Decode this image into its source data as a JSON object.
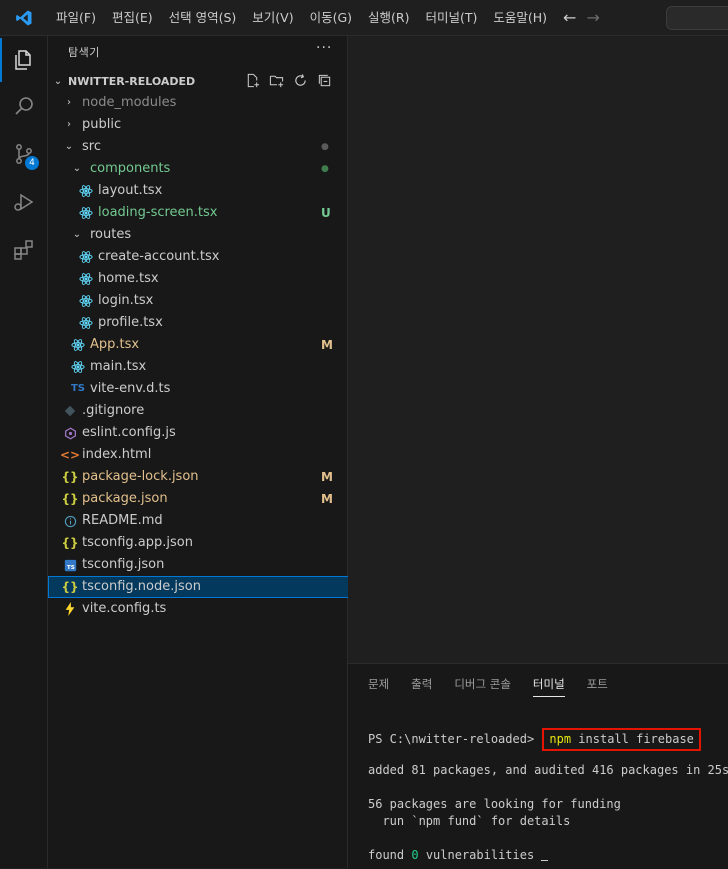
{
  "menu": {
    "items": [
      "파일(F)",
      "편집(E)",
      "선택 영역(S)",
      "보기(V)",
      "이동(G)",
      "실행(R)",
      "터미널(T)",
      "도움말(H)"
    ]
  },
  "activity_bar": {
    "source_control_badge": "4"
  },
  "explorer": {
    "title": "탐색기",
    "more": "···",
    "folder_name": "NWITTER-RELOADED",
    "items": [
      {
        "label": "node_modules",
        "depth": 0,
        "chevron": "›",
        "icon": "",
        "color": "#8b8b8b",
        "deco": "",
        "deco_color": ""
      },
      {
        "label": "public",
        "depth": 0,
        "chevron": "›",
        "icon": "",
        "color": "#cccccc",
        "deco": "",
        "deco_color": ""
      },
      {
        "label": "src",
        "depth": 0,
        "chevron": "⌄",
        "icon": "",
        "color": "#cccccc",
        "deco": "●",
        "deco_color": "#5a5a5a"
      },
      {
        "label": "components",
        "depth": 1,
        "chevron": "⌄",
        "icon": "",
        "color": "#73c991",
        "deco": "●",
        "deco_color": "#3f7d4f"
      },
      {
        "label": "layout.tsx",
        "depth": 2,
        "chevron": "",
        "icon": "react",
        "color": "#cccccc",
        "deco": "",
        "deco_color": ""
      },
      {
        "label": "loading-screen.tsx",
        "depth": 2,
        "chevron": "",
        "icon": "react",
        "color": "#73c991",
        "deco": "U",
        "deco_color": "#73c991"
      },
      {
        "label": "routes",
        "depth": 1,
        "chevron": "⌄",
        "icon": "",
        "color": "#cccccc",
        "deco": "",
        "deco_color": ""
      },
      {
        "label": "create-account.tsx",
        "depth": 2,
        "chevron": "",
        "icon": "react",
        "color": "#cccccc",
        "deco": "",
        "deco_color": ""
      },
      {
        "label": "home.tsx",
        "depth": 2,
        "chevron": "",
        "icon": "react",
        "color": "#cccccc",
        "deco": "",
        "deco_color": ""
      },
      {
        "label": "login.tsx",
        "depth": 2,
        "chevron": "",
        "icon": "react",
        "color": "#cccccc",
        "deco": "",
        "deco_color": ""
      },
      {
        "label": "profile.tsx",
        "depth": 2,
        "chevron": "",
        "icon": "react",
        "color": "#cccccc",
        "deco": "",
        "deco_color": ""
      },
      {
        "label": "App.tsx",
        "depth": 1,
        "chevron": "",
        "icon": "react",
        "color": "#e2c08d",
        "deco": "M",
        "deco_color": "#e2c08d"
      },
      {
        "label": "main.tsx",
        "depth": 1,
        "chevron": "",
        "icon": "react",
        "color": "#cccccc",
        "deco": "",
        "deco_color": ""
      },
      {
        "label": "vite-env.d.ts",
        "depth": 1,
        "chevron": "",
        "icon": "ts",
        "color": "#cccccc",
        "deco": "",
        "deco_color": ""
      },
      {
        "label": ".gitignore",
        "depth": 0,
        "chevron": "",
        "icon": "git",
        "color": "#cccccc",
        "deco": "",
        "deco_color": ""
      },
      {
        "label": "eslint.config.js",
        "depth": 0,
        "chevron": "",
        "icon": "eslint",
        "color": "#cccccc",
        "deco": "",
        "deco_color": ""
      },
      {
        "label": "index.html",
        "depth": 0,
        "chevron": "",
        "icon": "html",
        "color": "#cccccc",
        "deco": "",
        "deco_color": ""
      },
      {
        "label": "package-lock.json",
        "depth": 0,
        "chevron": "",
        "icon": "json",
        "color": "#e2c08d",
        "deco": "M",
        "deco_color": "#e2c08d"
      },
      {
        "label": "package.json",
        "depth": 0,
        "chevron": "",
        "icon": "json",
        "color": "#e2c08d",
        "deco": "M",
        "deco_color": "#e2c08d"
      },
      {
        "label": "README.md",
        "depth": 0,
        "chevron": "",
        "icon": "info",
        "color": "#cccccc",
        "deco": "",
        "deco_color": ""
      },
      {
        "label": "tsconfig.app.json",
        "depth": 0,
        "chevron": "",
        "icon": "json",
        "color": "#cccccc",
        "deco": "",
        "deco_color": ""
      },
      {
        "label": "tsconfig.json",
        "depth": 0,
        "chevron": "",
        "icon": "tsconfig",
        "color": "#cccccc",
        "deco": "",
        "deco_color": ""
      },
      {
        "label": "tsconfig.node.json",
        "depth": 0,
        "chevron": "",
        "icon": "json",
        "color": "#cccccc",
        "deco": "",
        "deco_color": "",
        "selected": true
      },
      {
        "label": "vite.config.ts",
        "depth": 0,
        "chevron": "",
        "icon": "vite",
        "color": "#cccccc",
        "deco": "",
        "deco_color": ""
      }
    ]
  },
  "panel": {
    "tabs": [
      "문제",
      "출력",
      "디버그 콘솔",
      "터미널",
      "포트"
    ],
    "active_tab": "터미널"
  },
  "terminal": {
    "prompt": "PS C:\\nwitter-reloaded> ",
    "cmd_npm": "npm",
    "cmd_rest": " install firebase",
    "line_added": "added 81 packages, and audited 416 packages in 25s",
    "line_funding": "56 packages are looking for funding",
    "line_fund_cmd": "  run `npm fund` for details",
    "found_prefix": "found ",
    "found_count": "0",
    "found_suffix": " vulnerabilities"
  },
  "colors": {
    "accent": "#0078d4",
    "modified": "#e2c08d",
    "untracked": "#73c991",
    "highlight_box": "#e51400"
  }
}
